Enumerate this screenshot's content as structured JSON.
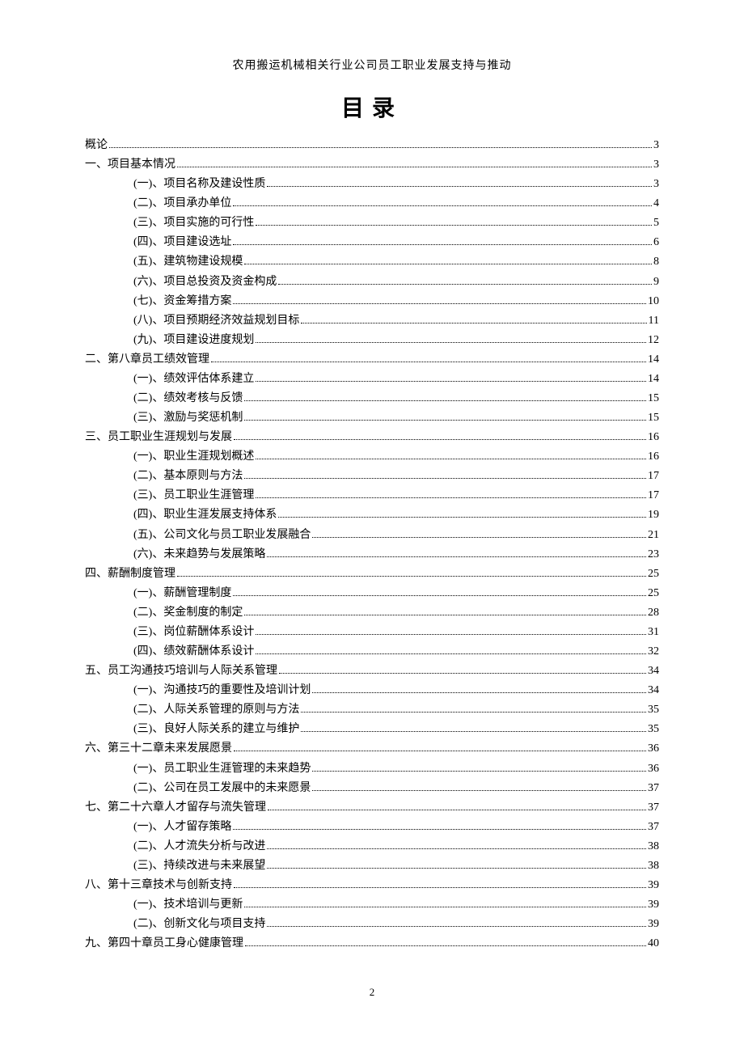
{
  "header": "农用搬运机械相关行业公司员工职业发展支持与推动",
  "toc_title": "目录",
  "page_number": "2",
  "toc": [
    {
      "level": 1,
      "label": "概论",
      "page": "3"
    },
    {
      "level": 1,
      "label": "一、项目基本情况",
      "page": "3"
    },
    {
      "level": 2,
      "label": "(一)、项目名称及建设性质",
      "page": "3"
    },
    {
      "level": 2,
      "label": "(二)、项目承办单位",
      "page": "4"
    },
    {
      "level": 2,
      "label": "(三)、项目实施的可行性",
      "page": "5"
    },
    {
      "level": 2,
      "label": "(四)、项目建设选址",
      "page": "6"
    },
    {
      "level": 2,
      "label": "(五)、建筑物建设规模",
      "page": "8"
    },
    {
      "level": 2,
      "label": "(六)、项目总投资及资金构成",
      "page": "9"
    },
    {
      "level": 2,
      "label": "(七)、资金筹措方案",
      "page": "10"
    },
    {
      "level": 2,
      "label": "(八)、项目预期经济效益规划目标",
      "page": "11"
    },
    {
      "level": 2,
      "label": "(九)、项目建设进度规划",
      "page": "12"
    },
    {
      "level": 1,
      "label": "二、第八章员工绩效管理",
      "page": "14"
    },
    {
      "level": 2,
      "label": "(一)、绩效评估体系建立",
      "page": "14"
    },
    {
      "level": 2,
      "label": "(二)、绩效考核与反馈",
      "page": "15"
    },
    {
      "level": 2,
      "label": "(三)、激励与奖惩机制",
      "page": "15"
    },
    {
      "level": 1,
      "label": "三、员工职业生涯规划与发展",
      "page": "16"
    },
    {
      "level": 2,
      "label": "(一)、职业生涯规划概述",
      "page": "16"
    },
    {
      "level": 2,
      "label": "(二)、基本原则与方法",
      "page": "17"
    },
    {
      "level": 2,
      "label": "(三)、员工职业生涯管理",
      "page": "17"
    },
    {
      "level": 2,
      "label": "(四)、职业生涯发展支持体系",
      "page": "19"
    },
    {
      "level": 2,
      "label": "(五)、公司文化与员工职业发展融合",
      "page": "21"
    },
    {
      "level": 2,
      "label": "(六)、未来趋势与发展策略",
      "page": "23"
    },
    {
      "level": 1,
      "label": "四、薪酬制度管理",
      "page": "25"
    },
    {
      "level": 2,
      "label": "(一)、薪酬管理制度",
      "page": "25"
    },
    {
      "level": 2,
      "label": "(二)、奖金制度的制定",
      "page": "28"
    },
    {
      "level": 2,
      "label": "(三)、岗位薪酬体系设计",
      "page": "31"
    },
    {
      "level": 2,
      "label": "(四)、绩效薪酬体系设计",
      "page": "32"
    },
    {
      "level": 1,
      "label": "五、员工沟通技巧培训与人际关系管理",
      "page": "34"
    },
    {
      "level": 2,
      "label": "(一)、沟通技巧的重要性及培训计划",
      "page": "34"
    },
    {
      "level": 2,
      "label": "(二)、人际关系管理的原则与方法",
      "page": "35"
    },
    {
      "level": 2,
      "label": "(三)、良好人际关系的建立与维护",
      "page": "35"
    },
    {
      "level": 1,
      "label": "六、第三十二章未来发展愿景",
      "page": "36"
    },
    {
      "level": 2,
      "label": "(一)、员工职业生涯管理的未来趋势",
      "page": "36"
    },
    {
      "level": 2,
      "label": "(二)、公司在员工发展中的未来愿景",
      "page": "37"
    },
    {
      "level": 1,
      "label": "七、第二十六章人才留存与流失管理",
      "page": "37"
    },
    {
      "level": 2,
      "label": "(一)、人才留存策略",
      "page": "37"
    },
    {
      "level": 2,
      "label": "(二)、人才流失分析与改进",
      "page": "38"
    },
    {
      "level": 2,
      "label": "(三)、持续改进与未来展望",
      "page": "38"
    },
    {
      "level": 1,
      "label": "八、第十三章技术与创新支持",
      "page": "39"
    },
    {
      "level": 2,
      "label": "(一)、技术培训与更新",
      "page": "39"
    },
    {
      "level": 2,
      "label": "(二)、创新文化与项目支持",
      "page": "39"
    },
    {
      "level": 1,
      "label": "九、第四十章员工身心健康管理",
      "page": "40"
    }
  ]
}
